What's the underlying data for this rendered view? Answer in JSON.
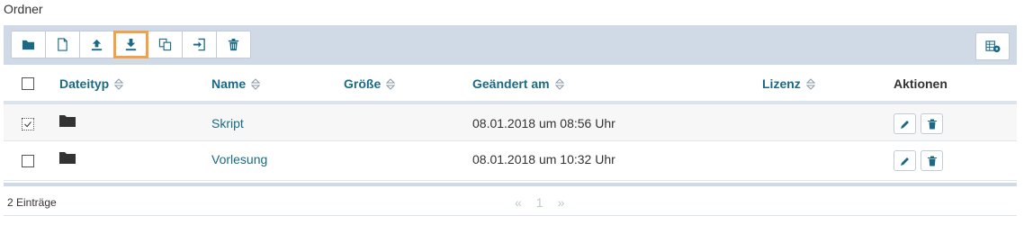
{
  "panel": {
    "title": "Ordner"
  },
  "toolbar": {
    "buttons": [
      {
        "name": "new-folder",
        "icon": "folder-icon"
      },
      {
        "name": "new-file",
        "icon": "file-icon"
      },
      {
        "name": "upload",
        "icon": "upload-icon"
      },
      {
        "name": "download",
        "icon": "download-icon",
        "active": true
      },
      {
        "name": "copy",
        "icon": "copy-icon"
      },
      {
        "name": "move",
        "icon": "move-into-icon"
      },
      {
        "name": "delete",
        "icon": "trash-icon"
      }
    ],
    "right_icon": "column-settings-icon"
  },
  "table": {
    "columns": {
      "type": "Dateityp",
      "name": "Name",
      "size": "Größe",
      "modified": "Geändert am",
      "license": "Lizenz",
      "actions": "Aktionen"
    },
    "rows": [
      {
        "checked": true,
        "type_icon": "folder-icon",
        "name": "Skript",
        "size": "",
        "modified": "08.01.2018 um 08:56 Uhr",
        "license": ""
      },
      {
        "checked": false,
        "type_icon": "folder-icon",
        "name": "Vorlesung",
        "size": "",
        "modified": "08.01.2018 um 10:32 Uhr",
        "license": ""
      }
    ]
  },
  "footer": {
    "count": "2 Einträge",
    "pager": {
      "prev": "«",
      "page": "1",
      "next": "»"
    }
  },
  "colors": {
    "accent": "#1a6a86",
    "toolbar_bg": "#d0dae6",
    "highlight": "#f0a24a"
  }
}
